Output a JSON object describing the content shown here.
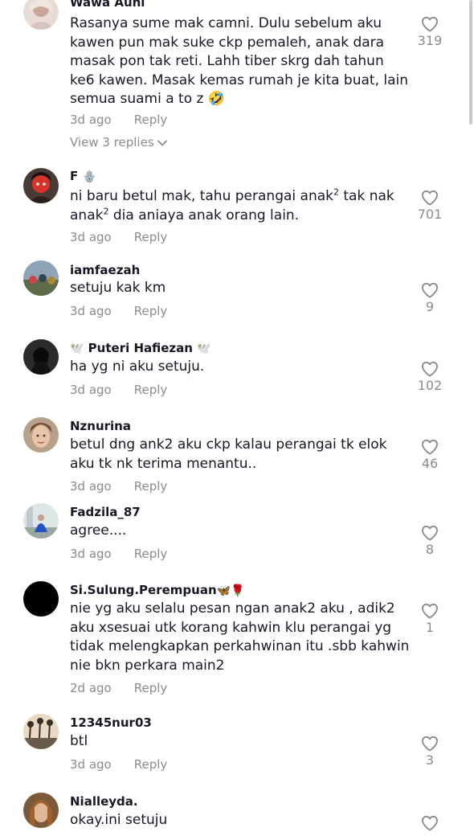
{
  "comments": [
    {
      "username": "Wawa Auni",
      "text": "Rasanya sume mak camni. Dulu sebelum aku kawen pun mak suke ckp pemaleh, anak dara masak pon tak reti. Lahh tiber skrg dah tahun ke6 kawen. Masak kemas rumah je kita buat, lain semua suami a to z 🤣",
      "time": "3d ago",
      "reply": "Reply",
      "likes": "319",
      "view_replies": "View 3 replies"
    },
    {
      "username": "F",
      "username_emoji": "🪬",
      "text_part1": "ni baru betul mak, tahu perangai anak",
      "sup1": "2",
      "text_part2": " tak nak anak",
      "sup2": "2",
      "text_part3": " dia aniaya anak orang lain.",
      "time": "3d ago",
      "reply": "Reply",
      "likes": "701"
    },
    {
      "username": "iamfaezah",
      "text": "setuju kak km",
      "time": "3d ago",
      "reply": "Reply",
      "likes": "9"
    },
    {
      "username": "Puteri Hafiezan",
      "username_emoji_left": "🕊️",
      "username_emoji_right": "🕊️",
      "text": "ha yg ni aku setuju.",
      "time": "3d ago",
      "reply": "Reply",
      "likes": "102"
    },
    {
      "username": "Nznurina",
      "text": "betul dng ank2 aku ckp kalau perangai tk elok aku tk nk terima menantu..",
      "time": "3d ago",
      "reply": "Reply",
      "likes": "46"
    },
    {
      "username": "Fadzila_87",
      "text": "agree....",
      "time": "3d ago",
      "reply": "Reply",
      "likes": "8"
    },
    {
      "username": "Si.Sulung.Perempuan",
      "username_emoji": "🦋🌹",
      "text": "nie yg aku selalu pesan ngan anak2 aku , adik2 aku xsesuai utk korang kahwin klu perangai yg tidak melengkapkan perkahwinan itu .sbb kahwin nie bkn perkara main2",
      "time": "2d ago",
      "reply": "Reply",
      "likes": "1"
    },
    {
      "username": "12345nur03",
      "text": "btl",
      "time": "3d ago",
      "reply": "Reply",
      "likes": "3"
    },
    {
      "username": "Nialleyda.",
      "text": "okay.ini setuju",
      "time": "",
      "reply": "",
      "likes": ""
    }
  ],
  "icons": {
    "like": "heart-outline-icon",
    "expand": "chevron-down-icon"
  },
  "colors": {
    "primary_text": "#161823",
    "secondary_text": "#8a8b91",
    "background": "#ffffff"
  }
}
